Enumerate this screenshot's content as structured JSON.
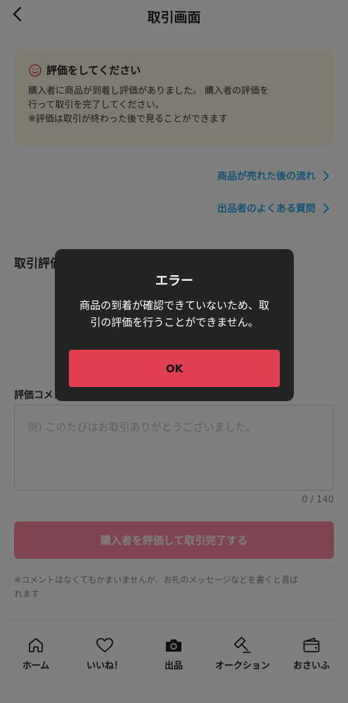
{
  "header": {
    "title": "取引画面"
  },
  "notice": {
    "title": "評価をしてください",
    "body_line1": "購入者に商品が到着し評価がありました。 購入者の評価を",
    "body_line2": "行って取引を完了してください。",
    "body_line3": "※評価は取引が終わった後で見ることができます"
  },
  "links": {
    "after_sale": "商品が売れた後の流れ",
    "faq": "出品者のよくある質問"
  },
  "evaluation": {
    "title": "取引評価"
  },
  "comment": {
    "title": "評価コメント",
    "placeholder": "例) このたびはお取引ありがとうございました。",
    "counter": "0 / 140"
  },
  "submit_label": "購入者を評価して取引完了する",
  "footnote_line1": "※コメントはなくてもかまいませんが、お礼のメッセージなどを書くと喜ば",
  "footnote_line2": "れます",
  "tabbar": {
    "home": "ホーム",
    "likes": "いいね！",
    "sell": "出品",
    "auction": "オークション",
    "wallet": "おさいふ"
  },
  "dialog": {
    "title": "エラー",
    "message_line1": "商品の到着が確認できていないため、取",
    "message_line2": "引の評価を行うことができません。",
    "ok_label": "OK"
  },
  "colors": {
    "accent_link": "#2ba6e8",
    "ok_button": "#e0404f",
    "submit_button": "#ff8aa0",
    "notice_bg": "#fcf6e2",
    "dialog_bg": "#242424"
  }
}
